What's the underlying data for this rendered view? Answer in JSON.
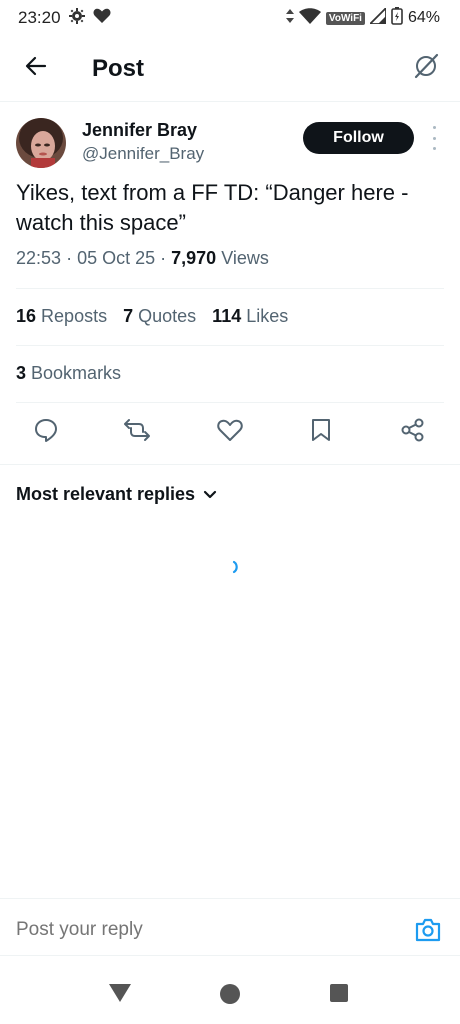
{
  "status_bar": {
    "time": "23:20",
    "network_label": "VoWiFi",
    "battery": "64%",
    "icons": [
      "settings-icon",
      "heart-icon",
      "data-arrows-icon",
      "wifi-icon",
      "signal-icon",
      "battery-icon"
    ]
  },
  "app_bar": {
    "title": "Post",
    "icons": [
      "back-arrow-icon",
      "grok-icon"
    ]
  },
  "post": {
    "author_name": "Jennifer Bray",
    "author_handle": "@Jennifer_Bray",
    "follow_label": "Follow",
    "text": "Yikes, text from a FF TD: “Danger here - watch this space”",
    "time": "22:53",
    "date": "05 Oct 25",
    "views_count": "7,970",
    "views_label": "Views"
  },
  "stats": {
    "reposts_count": "16",
    "reposts_label": "Reposts",
    "quotes_count": "7",
    "quotes_label": "Quotes",
    "likes_count": "114",
    "likes_label": "Likes",
    "bookmarks_count": "3",
    "bookmarks_label": "Bookmarks"
  },
  "actions": [
    "reply-icon",
    "repost-icon",
    "like-icon",
    "bookmark-icon",
    "share-icon"
  ],
  "replies": {
    "sort_label": "Most relevant replies"
  },
  "reply_composer": {
    "placeholder": "Post your reply"
  },
  "colors": {
    "accent": "#1d9bf0",
    "text_primary": "#0f1419",
    "text_secondary": "#536471",
    "follow_bg": "#0f1419"
  }
}
